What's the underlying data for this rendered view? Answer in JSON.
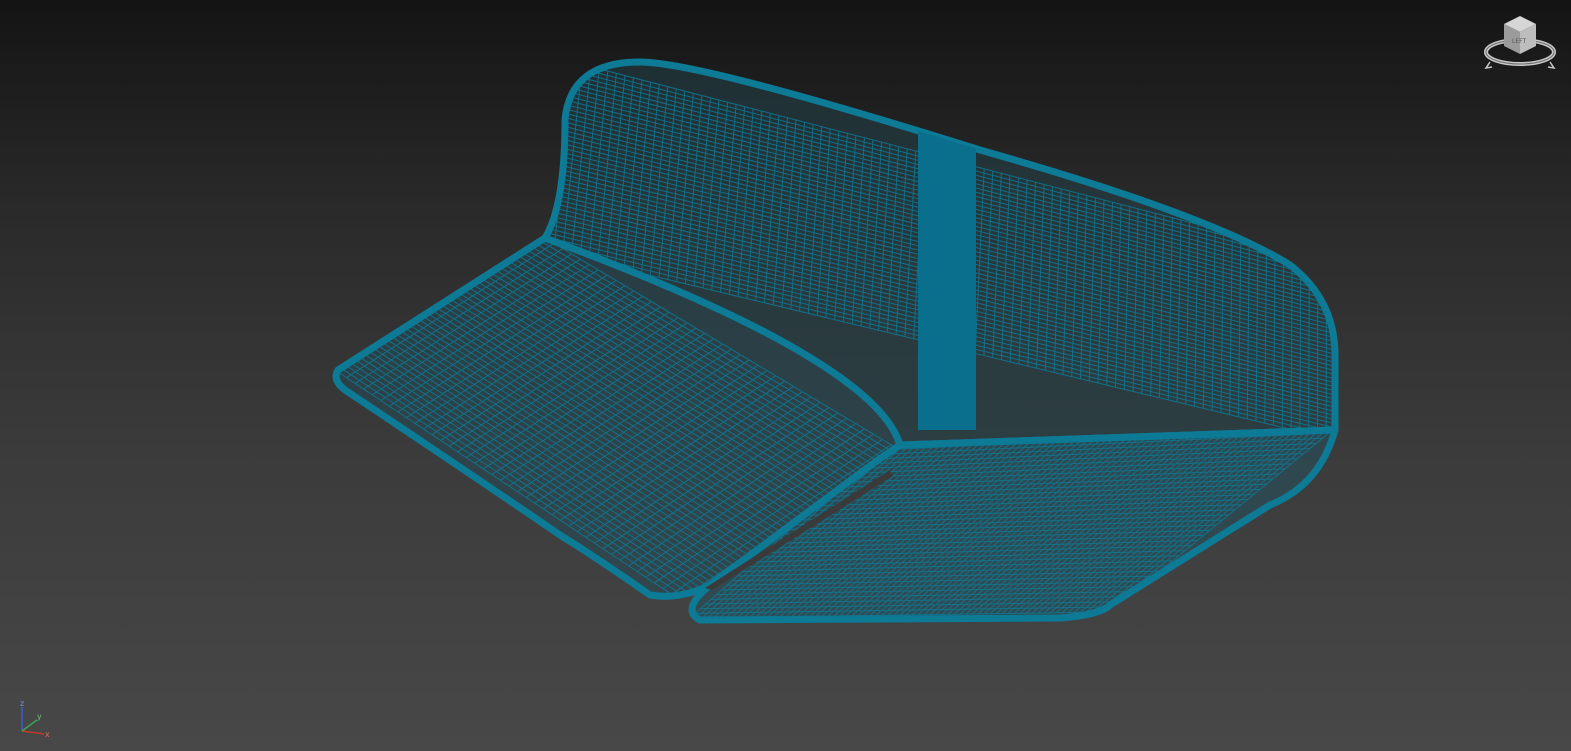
{
  "viewport": {
    "background_top": "#141414",
    "background_bottom": "#484848",
    "wire_color": "#0d7a96",
    "wire_fill": "#0a6f8c"
  },
  "viewcube": {
    "face_label": "LEFT",
    "face_color": "#bdbdbd",
    "ring_color": "#c8c8c8"
  },
  "axis_tripod": {
    "x_label": "x",
    "y_label": "y",
    "z_label": "z",
    "x_color": "#c0392b",
    "y_color": "#3fa34d",
    "z_color": "#3a5bd6"
  }
}
